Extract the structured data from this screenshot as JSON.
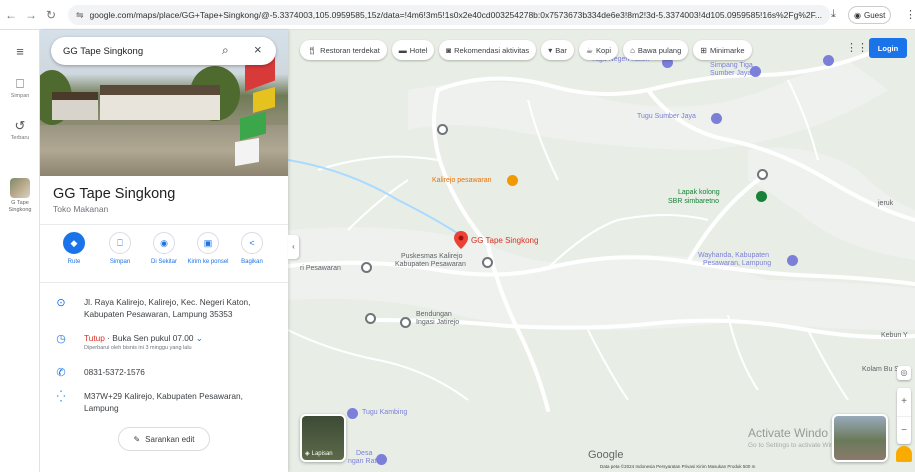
{
  "browser": {
    "url": "google.com/maps/place/GG+Tape+Singkong/@-5.3374003,105.0959585,15z/data=!4m6!3m5!1s0x2e40cd003254278b:0x7573673b334de6e3!8m2!3d-5.3374003!4d105.0959585!16s%2Fg%2F...",
    "guest_label": "Guest"
  },
  "rail": {
    "saved_label": "Simpan",
    "recent_label": "Terbaru",
    "thumb_label": "G Tape Singkong"
  },
  "search": {
    "value": "GG Tape Singkong"
  },
  "place": {
    "title": "GG Tape Singkong",
    "type": "Toko Makanan",
    "actions": [
      "Rute",
      "Simpan",
      "Di Sekitar",
      "Kirim ke ponsel",
      "Bagikan"
    ],
    "address": "Jl. Raya Kalirejo, Kalirejo, Kec. Negeri Katon, Kabupaten Pesawaran, Lampung 35353",
    "hours_status": "Tutup",
    "hours_next": " · Buka Sen pukul 07.00",
    "hours_note": "Diperbarui oleh bisnis ini 3 minggu yang lalu",
    "phone": "0831-5372-1576",
    "plus_code": "M37W+29 Kalirejo, Kabupaten Pesawaran, Lampung",
    "suggest_edit": "Sarankan edit"
  },
  "chips": [
    "Restoran terdekat",
    "Hotel",
    "Rekomendasi aktivitas",
    "Bar",
    "Kopi",
    "Bawa pulang",
    "Minimarke"
  ],
  "login_label": "Login",
  "map_labels": {
    "tugu_negeri_katon": "Tugu Negeri Katon",
    "simpang_tiga": "Simpang Tiga",
    "sumber_jaya": "Sumber Jaya",
    "tugu_sumber_jaya": "Tugu Sumber Jaya",
    "kalirejo_pesawaran": "Kalirejo pesawaran",
    "lapak_kolong": "Lapak kolong",
    "sbr_simbaretno": "SBR simbaretno",
    "gg_tape": "GG Tape Singkong",
    "puskesmas_1": "Puskesmas Kalirejo",
    "puskesmas_2": "Kabupaten Pesawaran",
    "ri_pesawaran": "ri Pesawaran",
    "wayhanda_1": "Wayhanda, Kabupaten",
    "wayhanda_2": "Pesawaran, Lampung",
    "bendungan_1": "Bendungan",
    "bendungan_2": "Ingasi Jatirejo",
    "kebun_y": "Kebun Y",
    "kolam_bu_sa": "Kolam Bu Sa",
    "tugu_kambing": "Tugu Kambing",
    "desa_1": "Desa",
    "desa_2": "ngan Ratu",
    "jeruk": "jeruk"
  },
  "layers_label": "Lapisan",
  "google_logo": "Google",
  "footer": "Data peta ©2024    Indonesia    Persyaratan    Privasi    Kirim Masukan Produk    500 m",
  "watermark": {
    "title": "Activate Windo",
    "sub": "Go to Settings to activate Windows."
  },
  "colors": {
    "accent": "#1a73e8",
    "closed": "#d93025",
    "map_bg": "#e8eee6",
    "road": "#ffffff"
  }
}
